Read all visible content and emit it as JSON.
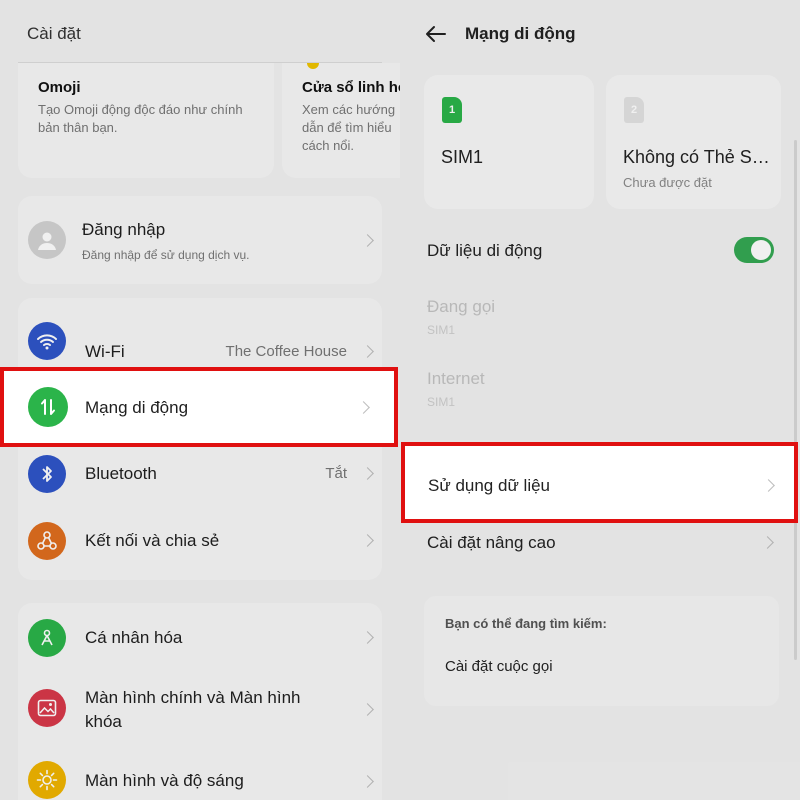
{
  "left_panel": {
    "title": "Cài đặt",
    "cards": [
      {
        "title": "Omoji",
        "desc": "Tạo Omoji động độc đáo như chính bản thân bạn."
      },
      {
        "title": "Cửa sổ linh hoạt",
        "desc": "Xem các hướng dẫn để tìm hiểu cách nổi."
      }
    ],
    "login": {
      "label": "Đăng nhập",
      "sub": "Đăng nhập để sử dụng dịch vụ."
    },
    "network_items": [
      {
        "label": "Wi-Fi",
        "value": "The Coffee House",
        "icon": "wifi-icon",
        "color": "#2f55c9"
      },
      {
        "label": "Mạng di động",
        "value": "",
        "icon": "mobile-data-icon",
        "color": "#2bb44a"
      },
      {
        "label": "Bluetooth",
        "value": "Tắt",
        "icon": "bluetooth-icon",
        "color": "#2f55c9"
      },
      {
        "label": "Kết nối và chia sẻ",
        "value": "",
        "icon": "connection-share-icon",
        "color": "#e06e1e"
      }
    ],
    "personal_items": [
      {
        "label": "Cá nhân hóa",
        "icon": "personalize-icon",
        "color": "#2bb44a"
      },
      {
        "label": "Màn hình chính và Màn hình khóa",
        "icon": "wallpaper-icon",
        "color": "#d8394a"
      },
      {
        "label": "Màn hình và độ sáng",
        "icon": "brightness-icon",
        "color": "#f0b400"
      }
    ]
  },
  "right_panel": {
    "title": "Mạng di động",
    "sims": [
      {
        "badge": "1",
        "name": "SIM1",
        "sub": "",
        "color": "#2bb44a"
      },
      {
        "badge": "2",
        "name": "Không có Thẻ SIM",
        "sub": "Chưa được đặt",
        "color": "#e0e0e0"
      }
    ],
    "mobile_data": {
      "label": "Dữ liệu di động",
      "enabled": true
    },
    "calling": {
      "label": "Đang gọi",
      "sub": "SIM1"
    },
    "internet": {
      "label": "Internet",
      "sub": "SIM1"
    },
    "data_usage": {
      "label": "Sử dụng dữ liệu"
    },
    "advanced": {
      "label": "Cài đặt nâng cao"
    },
    "search": {
      "heading": "Bạn có thể đang tìm kiếm:",
      "item": "Cài đặt cuộc gọi"
    }
  },
  "colors": {
    "highlight": "#e01010",
    "toggle_on": "#35a853"
  }
}
